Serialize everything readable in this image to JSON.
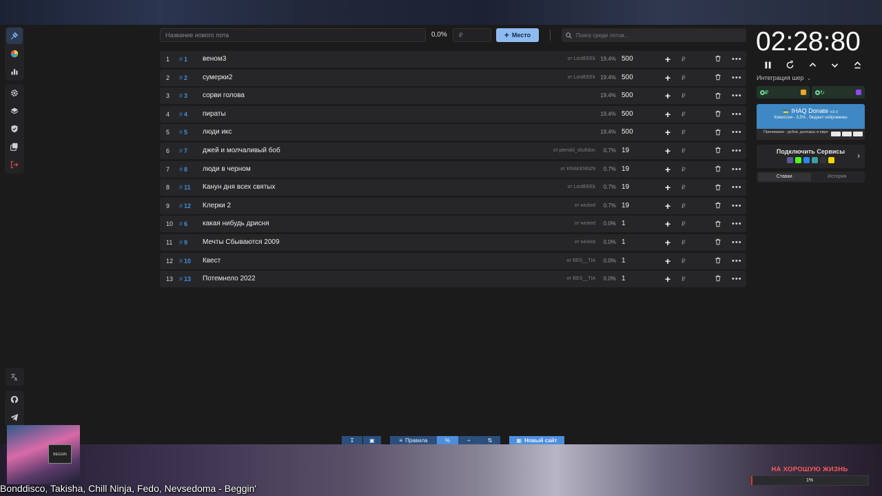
{
  "top_bar": {
    "lot_name_placeholder": "Название нового лота",
    "percent": "0,0%",
    "amount_placeholder": "₽",
    "place_button": "Место",
    "search_placeholder": "Поиск среди лотов..."
  },
  "lots": [
    {
      "index": "1",
      "id": "1",
      "name": "веном3",
      "from": "от LordEEEk",
      "percent": "19.4%",
      "amount": "500"
    },
    {
      "index": "2",
      "id": "2",
      "name": "сумерки2",
      "from": "от LordEEEk",
      "percent": "19.4%",
      "amount": "500"
    },
    {
      "index": "3",
      "id": "3",
      "name": "сорви голова",
      "from": "",
      "percent": "19.4%",
      "amount": "500"
    },
    {
      "index": "4",
      "id": "4",
      "name": "пираты",
      "from": "",
      "percent": "19.4%",
      "amount": "500"
    },
    {
      "index": "5",
      "id": "5",
      "name": "люди икс",
      "from": "",
      "percent": "19.4%",
      "amount": "500"
    },
    {
      "index": "6",
      "id": "7",
      "name": "джей и молчаливый боб",
      "from": "от pterskii_skufidon",
      "percent": "0.7%",
      "amount": "19"
    },
    {
      "index": "7",
      "id": "8",
      "name": "люди в черном",
      "from": "от KRAKENN29",
      "percent": "0.7%",
      "amount": "19"
    },
    {
      "index": "8",
      "id": "11",
      "name": "Канун дня всех святых",
      "from": "от LordEEEk",
      "percent": "0.7%",
      "amount": "19"
    },
    {
      "index": "9",
      "id": "12",
      "name": "Клерки 2",
      "from": "от wicked",
      "percent": "0.7%",
      "amount": "19"
    },
    {
      "index": "10",
      "id": "6",
      "name": "какая нибудь дрисня",
      "from": "от wicked",
      "percent": "0.0%",
      "amount": "1"
    },
    {
      "index": "11",
      "id": "9",
      "name": "Мечты Сбываются 2009",
      "from": "от wicked",
      "percent": "0.0%",
      "amount": "1"
    },
    {
      "index": "12",
      "id": "10",
      "name": "Квест",
      "from": "от BES__TIA",
      "percent": "0.0%",
      "amount": "1"
    },
    {
      "index": "13",
      "id": "13",
      "name": "Потемнело 2022",
      "from": "от BES__TIA",
      "percent": "0.0%",
      "amount": "1"
    }
  ],
  "lot_hash": "#",
  "lot_currency": "₽",
  "timer": {
    "value": "02:28:80"
  },
  "right_panel": {
    "integration_label": "Интеграция шер",
    "donate_title": "IHAQ Donate",
    "donate_version": "v3.0",
    "donate_sub": "Комиссия - 3,5% , бюджет нейромемы",
    "donate_foot": "Принимаем - рубли, доллары и евро",
    "connect_title": "Подключить Сервисы",
    "tab_bids": "Ставки",
    "tab_history": "История"
  },
  "bottom_toolbar": {
    "rules": "Правила",
    "new_site": "Новый сайт"
  },
  "overlay": {
    "now_playing": "Bonddisco, Takisha, Chill Ninja, Fedo, Nevsedoma - Beggin'",
    "thumb_sign": "BEGGIN",
    "goal_title": "НА ХОРОШУЮ ЖИЗНЬ",
    "goal_percent": "1%",
    "goal_progress": 0.01
  },
  "colors": {
    "accent": "#8fbcf0",
    "link": "#3f8ee0",
    "goal": "#ff5a5a"
  }
}
